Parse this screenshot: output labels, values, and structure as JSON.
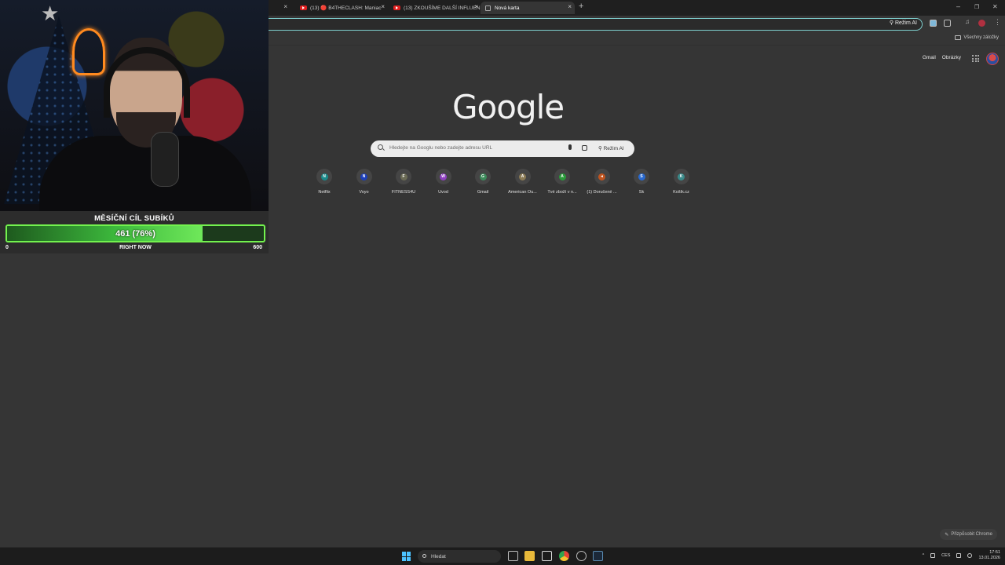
{
  "browser": {
    "tabs": [
      {
        "label": "(13) 🔴 B4THECLASH: Maniac",
        "kind": "youtube"
      },
      {
        "label": "(13) ZKOUŠÍME DALŠÍ INFLUEN",
        "kind": "youtube"
      },
      {
        "label": "Nová karta",
        "kind": "newtab",
        "active": true
      }
    ],
    "new_tab_symbol": "+",
    "close_symbol": "×",
    "window_controls": [
      "–",
      "❐",
      "✕"
    ],
    "omnibox_ai_label": "Režim AI",
    "bookmarks_all_label": "Všechny záložky"
  },
  "newtab": {
    "top_links": [
      "Gmail",
      "Obrázky"
    ],
    "logo_text": "Google",
    "search": {
      "placeholder": "Hledejte na Googlu nebo zadejte adresu URL",
      "ai_label": "Režim AI"
    },
    "shortcuts": [
      {
        "label": "Netflix",
        "letter": "N",
        "color": "#1a8a8a"
      },
      {
        "label": "Voyo",
        "letter": "N",
        "color": "#1d3fb8"
      },
      {
        "label": "FITNESS4U",
        "letter": "F",
        "color": "#6b6b55"
      },
      {
        "label": "Úvod",
        "letter": "W",
        "color": "#8e3fc0"
      },
      {
        "label": "Gmail",
        "letter": "G",
        "color": "#3c8a5a"
      },
      {
        "label": "American Ou...",
        "letter": "A",
        "color": "#8a7a55"
      },
      {
        "label": "Tvé zboží v n...",
        "letter": "A",
        "color": "#2a9a3a"
      },
      {
        "label": "(1) Doručené ...",
        "letter": "◂",
        "color": "#c0541f"
      },
      {
        "label": "Sk",
        "letter": "S",
        "color": "#2a6ad0"
      },
      {
        "label": "Košík.cz",
        "letter": "K",
        "color": "#3a8a8a"
      }
    ],
    "customize_label": "Přizpůsobit Chrome"
  },
  "overlay": {
    "goal_title": "MĚSÍČNÍ CÍL SUBÍKŮ",
    "goal_value_text": "461 (76%)",
    "goal_fraction": 0.76,
    "min_label": "0",
    "now_label": "RIGHT NOW",
    "max_label": "600"
  },
  "taskbar": {
    "search_placeholder": "Hledat",
    "language": "CES",
    "time": "17:51",
    "date": "13.01.2026",
    "tray_up_arrow": "^"
  }
}
